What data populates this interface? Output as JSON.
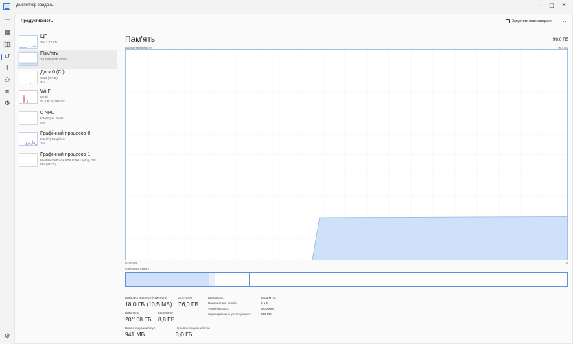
{
  "window": {
    "title": "Диспетчер завдань",
    "minimize": "–",
    "maximize": "▢",
    "close": "✕"
  },
  "nav": {
    "icons": [
      "hamburger-icon",
      "processes-icon",
      "performance-icon",
      "history-icon",
      "startup-icon",
      "users-icon",
      "details-icon",
      "services-icon"
    ],
    "settings": "settings-icon"
  },
  "header": {
    "page_title": "Продуктивність",
    "run_task": "Запустити нове завдання",
    "more": "..."
  },
  "devices": [
    {
      "name": "ЦП",
      "sub1": "3% 2,73 ГГц",
      "sub2": "",
      "sub3": ""
    },
    {
      "name": "Пам'ять",
      "sub1": "19,6/95,6 ГБ (20%)",
      "sub2": "",
      "sub3": ""
    },
    {
      "name": "Диск 0 (C:)",
      "sub1": "SSD (RAID)",
      "sub2": "1%",
      "sub3": ""
    },
    {
      "name": "Wi-Fi",
      "sub1": "Wi-Fi",
      "sub2": "S: 0 R: 8,0 Кбіт/с",
      "sub3": ""
    },
    {
      "name": "0 NPU",
      "sub1": "Intel(R) AI Boost",
      "sub2": "0%",
      "sub3": ""
    },
    {
      "name": "Графічний процесор 0",
      "sub1": "Intel(R) Graphics",
      "sub2": "1%",
      "sub3": ""
    },
    {
      "name": "Графічний процесор 1",
      "sub1": "NVIDIA GeForce RTX 5090 Laptop GPU",
      "sub2": "0% (43 °C)",
      "sub3": ""
    }
  ],
  "memory": {
    "title": "Пам'ять",
    "total": "96,0 ГБ",
    "usage_label": "Використання пам'яті",
    "usage_max": "96,4 ГБ",
    "axis_left": "60 секунд",
    "axis_right": "0",
    "composition_label": "Композиція пам'яті",
    "usage_level_fraction": 0.2,
    "stats": {
      "in_use_label": "Використовується (стиснуто)",
      "in_use_value": "18,0 ГБ (10,5 МБ)",
      "available_label": "Доступно",
      "available_value": "76,0 ГБ",
      "committed_label": "Виконано",
      "committed_value": "20/108 ГБ",
      "cached_label": "Кешовано",
      "cached_value": "8,8 ГБ",
      "paged_label": "Вивантажуваний пул",
      "paged_value": "941 МБ",
      "nonpaged_label": "Невивантажуваний пул",
      "nonpaged_value": "3,0 ГБ"
    },
    "right": [
      {
        "label": "Швидкість:",
        "value": "6400 МТ/с"
      },
      {
        "label": "Використано слотів:",
        "value": "2 з 2"
      },
      {
        "label": "Форм-фактор:",
        "value": "SODIMM"
      },
      {
        "label": "Зарезервоване устаткування:",
        "value": "593 МБ"
      }
    ]
  },
  "colors": {
    "accent": "#2f6fd6",
    "memory_fill": "#cfe1f8",
    "memory_line": "#8db4e8"
  }
}
